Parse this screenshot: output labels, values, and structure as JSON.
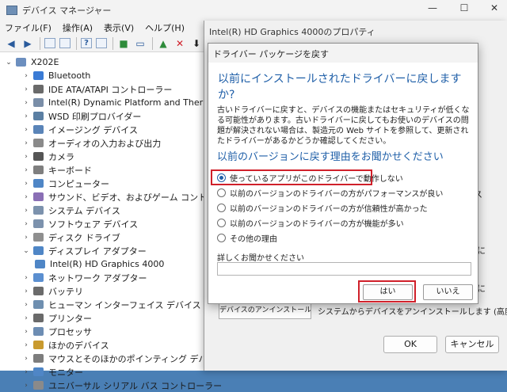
{
  "device_manager": {
    "title": "デバイス マネージャー",
    "window_controls": {
      "minimize": "—",
      "maximize": "☐",
      "close": "✕"
    },
    "menu": [
      "ファイル(F)",
      "操作(A)",
      "表示(V)",
      "ヘルプ(H)"
    ],
    "toolbar_icons": [
      "back-icon",
      "forward-icon",
      "properties-icon",
      "list-icon",
      "help-icon",
      "refresh-icon",
      "scan-icon",
      "monitor-icon",
      "update-driver-icon",
      "uninstall-icon",
      "disable-icon"
    ],
    "tree": {
      "root": "X202E",
      "items": [
        {
          "label": "Bluetooth",
          "expanded": false
        },
        {
          "label": "IDE ATA/ATAPI コントローラー",
          "expanded": false
        },
        {
          "label": "Intel(R) Dynamic Platform and Thermal Framew",
          "expanded": false
        },
        {
          "label": "WSD 印刷プロバイダー",
          "expanded": false
        },
        {
          "label": "イメージング デバイス",
          "expanded": false
        },
        {
          "label": "オーディオの入力および出力",
          "expanded": false
        },
        {
          "label": "カメラ",
          "expanded": false
        },
        {
          "label": "キーボード",
          "expanded": false
        },
        {
          "label": "コンピューター",
          "expanded": false
        },
        {
          "label": "サウンド、ビデオ、およびゲーム コントローラー",
          "expanded": false
        },
        {
          "label": "システム デバイス",
          "expanded": false
        },
        {
          "label": "ソフトウェア デバイス",
          "expanded": false
        },
        {
          "label": "ディスク ドライブ",
          "expanded": false
        },
        {
          "label": "ディスプレイ アダプター",
          "expanded": true
        },
        {
          "label": "Intel(R) HD Graphics 4000",
          "child": true
        },
        {
          "label": "ネットワーク アダプター",
          "expanded": false
        },
        {
          "label": "バッテリ",
          "expanded": false
        },
        {
          "label": "ヒューマン インターフェイス デバイス",
          "expanded": false
        },
        {
          "label": "プリンター",
          "expanded": false
        },
        {
          "label": "プロセッサ",
          "expanded": false
        },
        {
          "label": "ほかのデバイス",
          "expanded": false
        },
        {
          "label": "マウスとそのほかのポインティング デバイス",
          "expanded": false
        },
        {
          "label": "モニター",
          "expanded": false
        },
        {
          "label": "ユニバーサル シリアル バス コントローラー",
          "expanded": false
        }
      ]
    }
  },
  "properties_dialog": {
    "title": "Intel(R) HD Graphics 4000のプロパティ",
    "side_fragments": [
      "ス",
      "に",
      "に"
    ],
    "driver_details_button": "デバイスのアンインストール(U)",
    "uninstall_note": "システムからデバイスをアンインストールします (高度)。",
    "ok_button": "OK",
    "cancel_button": "キャンセル"
  },
  "rollback_dialog": {
    "title": "ドライバー パッケージを戻す",
    "question": "以前にインストールされたドライバーに戻しますか?",
    "description": "古いドライバーに戻すと、デバイスの機能またはセキュリティが低くなる可能性があります。古いドライバーに戻してもお使いのデバイスの問題が解決されない場合は、製造元の Web サイトを参照して、更新されたドライバーがあるかどうか確認してください。",
    "reason_heading": "以前のバージョンに戻す理由をお聞かせください",
    "reasons": [
      {
        "label": "使っているアプリがこのドライバーで動作しない",
        "selected": true
      },
      {
        "label": "以前のバージョンのドライバーの方がパフォーマンスが良い",
        "selected": false
      },
      {
        "label": "以前のバージョンのドライバーの方が信頼性が高かった",
        "selected": false
      },
      {
        "label": "以前のバージョンのドライバーの方が機能が多い",
        "selected": false
      },
      {
        "label": "その他の理由",
        "selected": false
      }
    ],
    "detail_label": "詳しくお聞かせください",
    "detail_value": "",
    "yes_button": "はい",
    "no_button": "いいえ"
  },
  "colors": {
    "highlight_border": "#d0202a",
    "heading_blue": "#1f5fa8",
    "desktop": "#4a7fb5"
  }
}
